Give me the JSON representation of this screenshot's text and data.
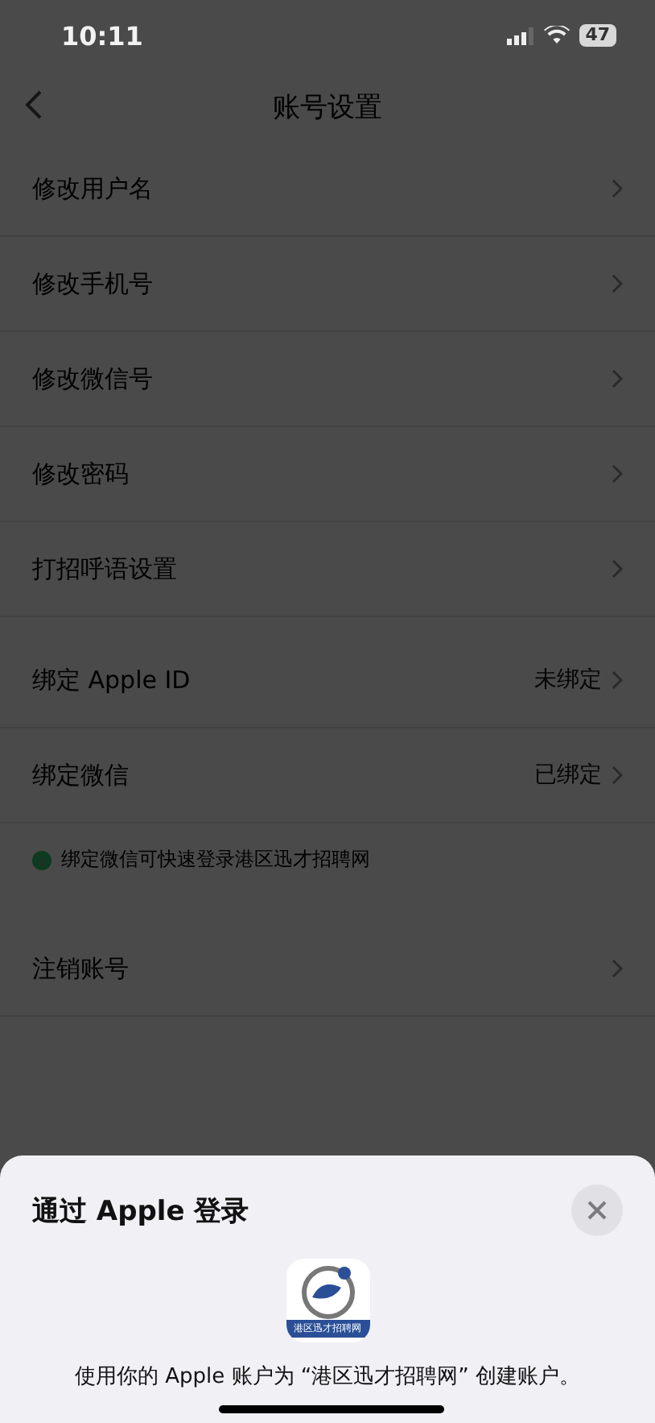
{
  "status_bar": {
    "time": "10:11",
    "battery": "47"
  },
  "nav": {
    "title": "账号设置"
  },
  "groups": [
    {
      "items": [
        {
          "label": "修改用户名"
        },
        {
          "label": "修改手机号"
        },
        {
          "label": "修改微信号"
        },
        {
          "label": "修改密码"
        },
        {
          "label": "打招呼语设置"
        }
      ]
    },
    {
      "items": [
        {
          "label": "绑定 Apple ID",
          "value": "未绑定"
        },
        {
          "label": "绑定微信",
          "value": "已绑定"
        }
      ],
      "hint": "绑定微信可快速登录港区迅才招聘网"
    },
    {
      "items": [
        {
          "label": "注销账号"
        }
      ]
    }
  ],
  "sheet": {
    "title": "通过 Apple 登录",
    "app_icon_caption": "港区迅才招聘网",
    "message": "使用你的 Apple 账户为 “港区迅才招聘网” 创建账户。"
  }
}
